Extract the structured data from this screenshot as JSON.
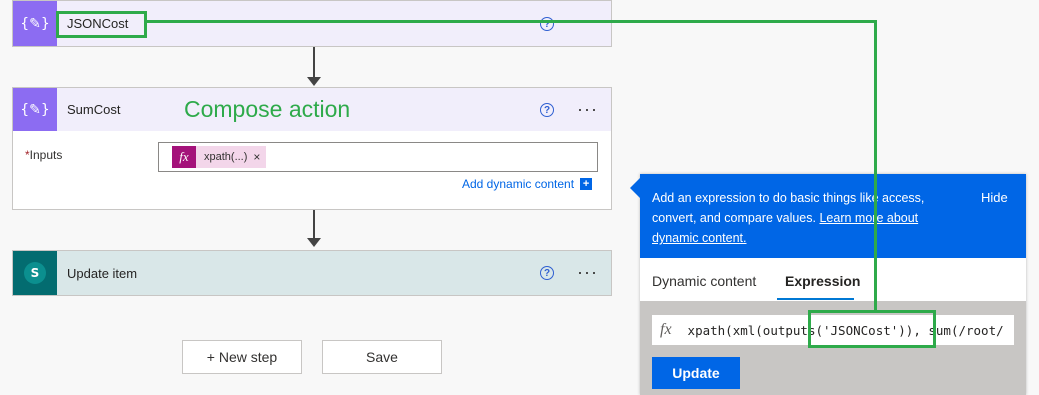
{
  "top_action": {
    "title": "JSONCost",
    "help": "?",
    "more": "···"
  },
  "compose_action": {
    "title": "SumCost",
    "annotation": "Compose action",
    "required_mark": "*",
    "inputs_label": "Inputs",
    "token_icon": "fx",
    "token_label": "xpath(...)",
    "token_close": "×",
    "add_dynamic": "Add dynamic content",
    "add_icon": "+",
    "help": "?",
    "more": "···"
  },
  "update_action": {
    "title": "Update item",
    "icon_letter": "S",
    "help": "?",
    "more": "···"
  },
  "buttons": {
    "new_step": "+ New step",
    "save": "Save"
  },
  "expression_panel": {
    "info_text_1": "Add an expression to do basic things like access,",
    "info_text_2": "convert, and compare values.",
    "link_text_1": "Learn more about",
    "link_text_2": "dynamic content.",
    "hide": "Hide",
    "tabs": [
      "Dynamic content",
      "Expression"
    ],
    "active_tab": "Expression",
    "fx": "fx",
    "expression": "xpath(xml(outputs('JSONCost')), sum(/root/",
    "update_button": "Update"
  },
  "colors": {
    "accent": "#0066e6",
    "compose_icon": "#8c6cf2",
    "sharepoint_icon": "#036c70",
    "highlight": "#2eaa4a",
    "annotation": "#2eaa4a"
  }
}
